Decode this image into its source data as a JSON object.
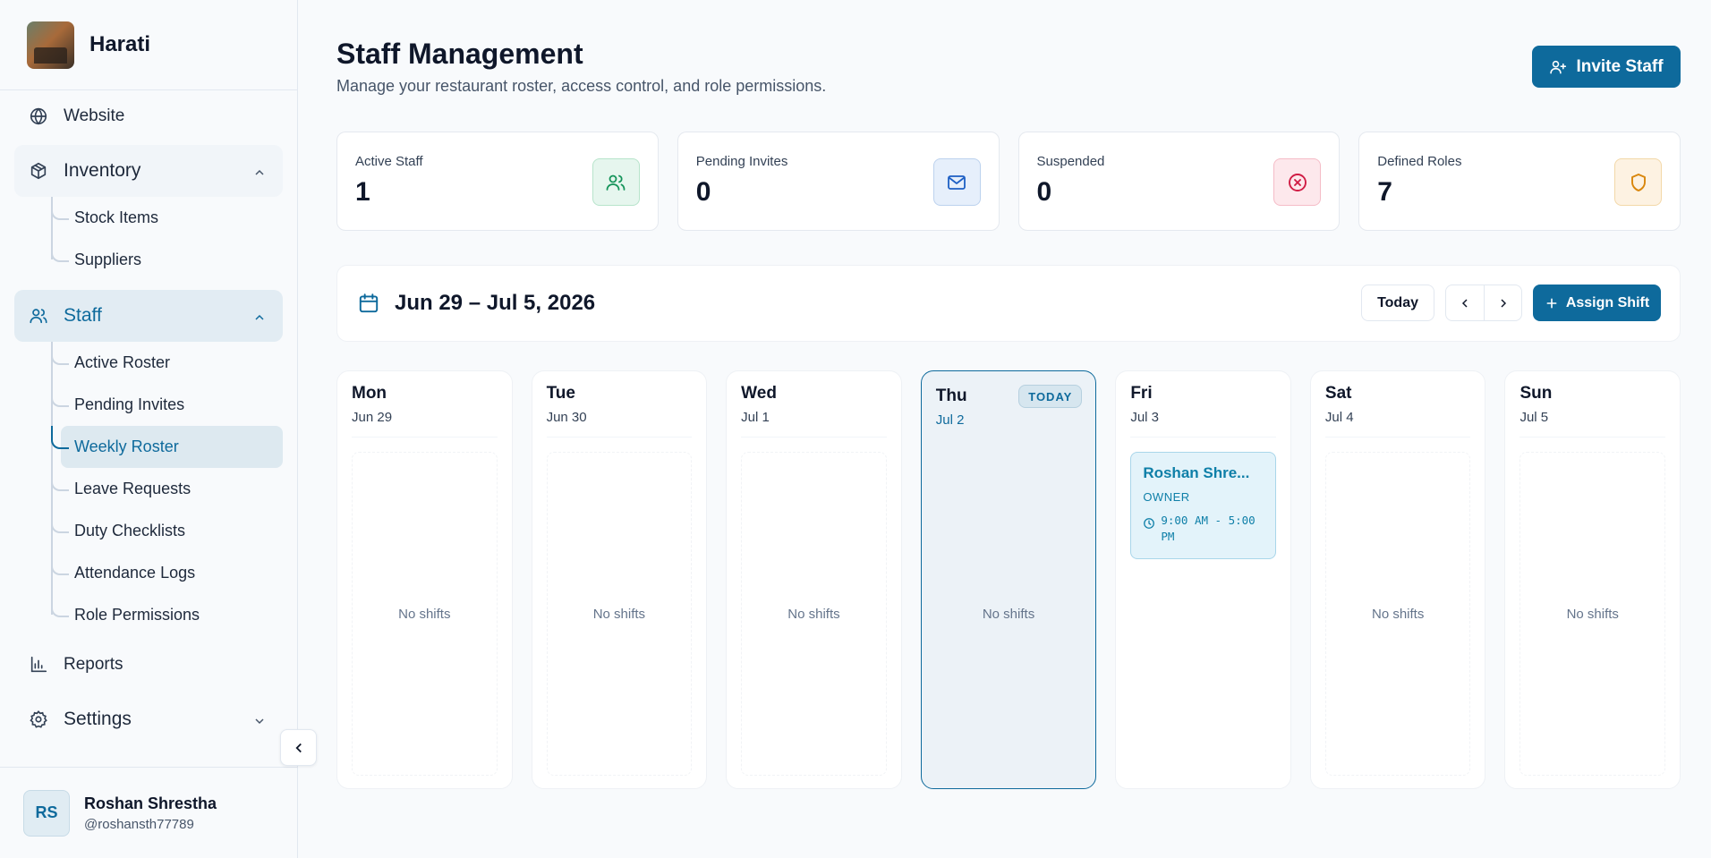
{
  "sidebar": {
    "brand": "Harati",
    "website": "Website",
    "inventory": {
      "label": "Inventory",
      "items": [
        "Stock Items",
        "Suppliers"
      ]
    },
    "staff": {
      "label": "Staff",
      "items": [
        "Active Roster",
        "Pending Invites",
        "Weekly Roster",
        "Leave Requests",
        "Duty Checklists",
        "Attendance Logs",
        "Role Permissions"
      ],
      "active": "Weekly Roster"
    },
    "reports": "Reports",
    "settings": "Settings",
    "user": {
      "initials": "RS",
      "name": "Roshan Shrestha",
      "handle": "@roshansth77789"
    }
  },
  "header": {
    "title": "Staff Management",
    "subtitle": "Manage your restaurant roster, access control, and role permissions.",
    "invite_label": "Invite Staff"
  },
  "stats": [
    {
      "label": "Active Staff",
      "value": "1",
      "icon": "users-icon",
      "bg": "#e6f6ee",
      "border": "#b7e4cb",
      "color": "#15945a"
    },
    {
      "label": "Pending Invites",
      "value": "0",
      "icon": "mail-icon",
      "bg": "#e6effb",
      "border": "#bcd2ee",
      "color": "#1d5fc4"
    },
    {
      "label": "Suspended",
      "value": "0",
      "icon": "x-circle-icon",
      "bg": "#fde8ec",
      "border": "#f5bcc7",
      "color": "#d01c44"
    },
    {
      "label": "Defined Roles",
      "value": "7",
      "icon": "shield-icon",
      "bg": "#fdf2e2",
      "border": "#f3d8a8",
      "color": "#d9860b"
    }
  ],
  "toolbar": {
    "range": "Jun 29 – Jul 5, 2026",
    "today_label": "Today",
    "assign_label": "Assign Shift"
  },
  "week": {
    "empty_label": "No shifts",
    "today_badge": "TODAY",
    "days": [
      {
        "name": "Mon",
        "date": "Jun 29"
      },
      {
        "name": "Tue",
        "date": "Jun 30"
      },
      {
        "name": "Wed",
        "date": "Jul 1"
      },
      {
        "name": "Thu",
        "date": "Jul 2"
      },
      {
        "name": "Fri",
        "date": "Jul 3"
      },
      {
        "name": "Sat",
        "date": "Jul 4"
      },
      {
        "name": "Sun",
        "date": "Jul 5"
      }
    ],
    "shift": {
      "name": "Roshan Shre...",
      "role": "OWNER",
      "time": "9:00 AM - 5:00 PM"
    }
  },
  "colors": {
    "accent": "#0e6a9c"
  }
}
